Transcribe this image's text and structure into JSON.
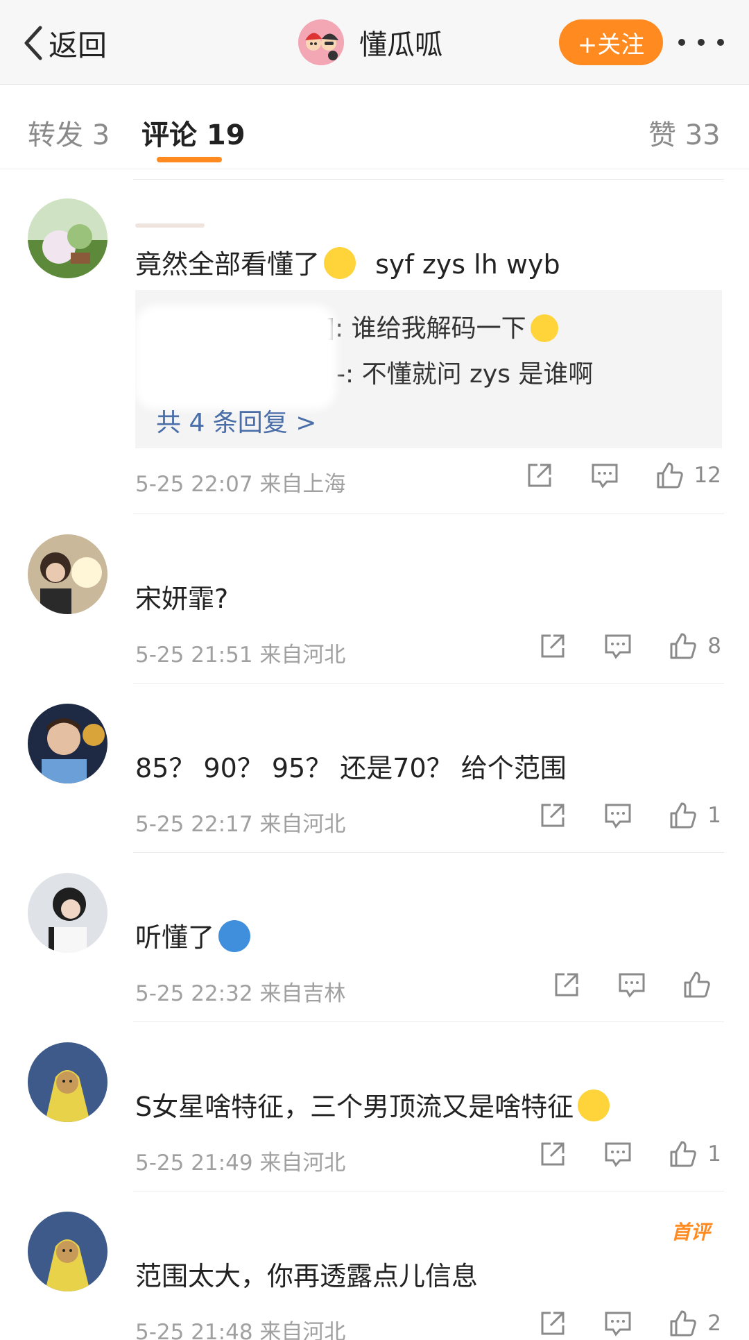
{
  "header": {
    "back_label": "返回",
    "title": "懂瓜呱",
    "follow_label": "+关注"
  },
  "tabs": {
    "reposts": "转发 3",
    "comments": "评论 19",
    "likes": "赞 33"
  },
  "comments": [
    {
      "text": "竟然全部看懂了",
      "text_suffix": "syf  zys  lh wyb",
      "emoji": "laughing-tears-emoji",
      "replies": [
        {
          "text": "]: 谁给我解码一下",
          "emoji": "thinking-emoji"
        },
        {
          "text": "-: 不懂就问 zys 是谁啊"
        }
      ],
      "reply_more": "共 4 条回复 >",
      "meta": "5-25 22:07  来自上海",
      "likes": "12"
    },
    {
      "text": "宋妍霏?",
      "meta": "5-25 21:51  来自河北",
      "likes": "8"
    },
    {
      "text": "85？ 90？ 95？ 还是70？ 给个范围",
      "meta": "5-25 22:17  来自河北",
      "likes": "1"
    },
    {
      "text": "听懂了",
      "emoji": "doraemon-emoji",
      "meta": "5-25 22:32  来自吉林",
      "likes": ""
    },
    {
      "text": "S女星啥特征，三个男顶流又是啥特征",
      "emoji": "dizzy-emoji",
      "meta": "5-25 21:49  来自河北",
      "likes": "1"
    },
    {
      "text": "范围太大，你再透露点儿信息",
      "badge": "首评",
      "meta": "5-25 21:48  来自河北",
      "likes": "2"
    }
  ],
  "colors": {
    "accent": "#ff8a1f",
    "link": "#4a6ea8",
    "meta": "#a0a0a0"
  }
}
